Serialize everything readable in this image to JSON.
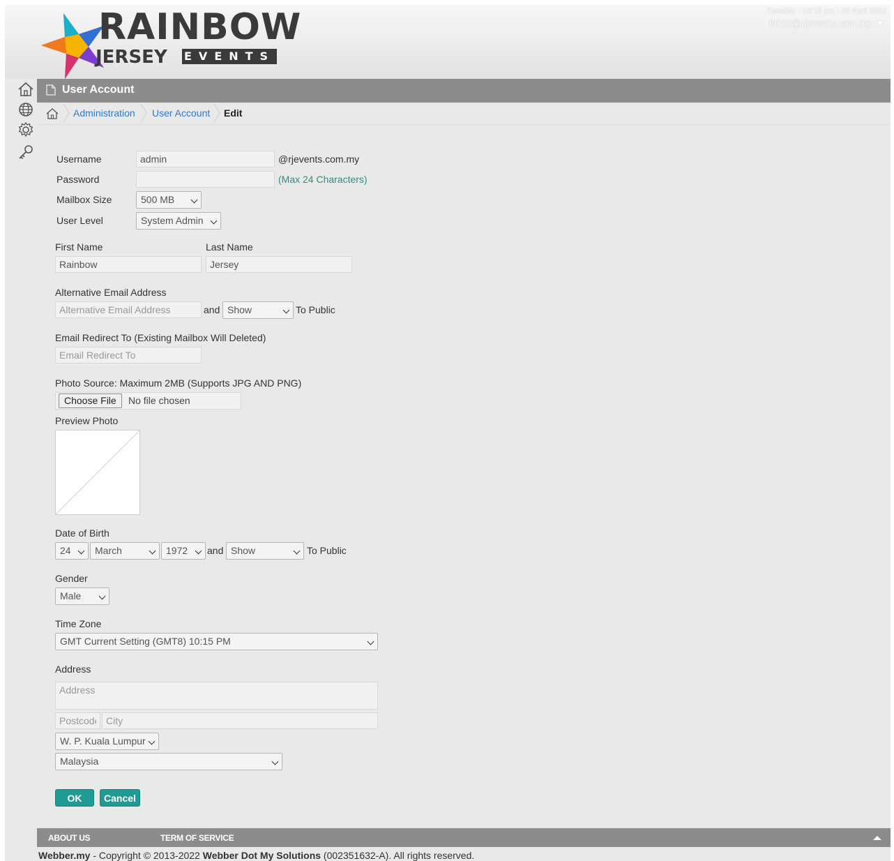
{
  "header": {
    "brand_top": "RAINBOW",
    "brand_bottom": "JERSEY",
    "brand_events": "EVENTS",
    "datetime": "Tuesday • 10:15 pm • 05 April 2022",
    "user_email": "faizal@rjevents.com.my ▼"
  },
  "sidebar": {
    "icons": [
      "home-icon",
      "globe-icon",
      "gear-icon",
      "key-icon"
    ]
  },
  "page": {
    "title": "User Account",
    "breadcrumb": [
      "Administration",
      "User Account",
      "Edit"
    ]
  },
  "form": {
    "username_label": "Username",
    "username_value": "admin",
    "username_suffix": "@rjevents.com.my",
    "password_label": "Password",
    "password_hint": "(Max 24 Characters)",
    "mailbox_label": "Mailbox Size",
    "mailbox_value": "500 MB",
    "userlevel_label": "User Level",
    "userlevel_value": "System Admin",
    "firstname_label": "First Name",
    "firstname_value": "Rainbow",
    "lastname_label": "Last Name",
    "lastname_value": "Jersey",
    "alt_email_label": "Alternative Email Address",
    "alt_email_placeholder": "Alternative Email Address",
    "and_text": "and",
    "alt_email_visibility": "Show",
    "to_public_text": "To Public",
    "redirect_label": "Email Redirect To (Existing Mailbox Will Deleted)",
    "redirect_placeholder": "Email Redirect To",
    "photo_label": "Photo Source: Maximum 2MB (Supports JPG AND PNG)",
    "choose_file": "Choose File",
    "no_file": "No file chosen",
    "preview_label": "Preview Photo",
    "dob_label": "Date of Birth",
    "dob_day": "24",
    "dob_month": "March",
    "dob_year": "1972",
    "dob_visibility": "Show",
    "gender_label": "Gender",
    "gender_value": "Male",
    "timezone_label": "Time Zone",
    "timezone_value": "GMT Current Setting (GMT8) 10:15 PM",
    "address_label": "Address",
    "address_placeholder": "Address",
    "postcode_placeholder": "Postcode",
    "city_placeholder": "City",
    "state_value": "W. P. Kuala Lumpur",
    "country_value": "Malaysia",
    "ok_label": "OK",
    "cancel_label": "Cancel"
  },
  "footer": {
    "about": "ABOUT US",
    "terms": "TERM OF SERVICE",
    "copyright_brand": "Webber.my",
    "copyright_mid": " - Copyright © 2013-2022 ",
    "copyright_company": "Webber Dot My Solutions",
    "copyright_tail": " (002351632-A). All rights reserved."
  },
  "colors": {
    "accent": "#1e9c94",
    "title_bar": "#8c8c8c",
    "link": "#2b7bd0"
  }
}
